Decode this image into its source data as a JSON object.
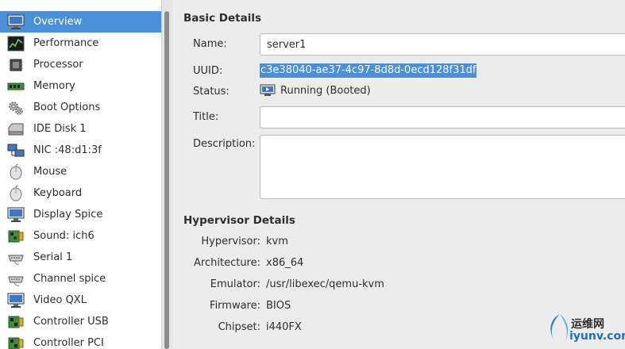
{
  "sidebar": {
    "items": [
      {
        "label": "Overview",
        "icon": "monitor-icon",
        "selected": true
      },
      {
        "label": "Performance",
        "icon": "performance-graph-icon"
      },
      {
        "label": "Processor",
        "icon": "cpu-chip-icon"
      },
      {
        "label": "Memory",
        "icon": "memory-stick-icon"
      },
      {
        "label": "Boot Options",
        "icon": "gears-icon"
      },
      {
        "label": "IDE Disk 1",
        "icon": "hard-disk-icon"
      },
      {
        "label": "NIC :48:d1:3f",
        "icon": "network-icon"
      },
      {
        "label": "Mouse",
        "icon": "mouse-icon"
      },
      {
        "label": "Keyboard",
        "icon": "keyboard-icon"
      },
      {
        "label": "Display Spice",
        "icon": "display-icon"
      },
      {
        "label": "Sound: ich6",
        "icon": "sound-card-icon"
      },
      {
        "label": "Serial 1",
        "icon": "serial-port-icon"
      },
      {
        "label": "Channel spice",
        "icon": "channel-icon"
      },
      {
        "label": "Video QXL",
        "icon": "video-card-icon"
      },
      {
        "label": "Controller USB",
        "icon": "controller-card-icon"
      },
      {
        "label": "Controller PCI",
        "icon": "controller-card-icon"
      }
    ]
  },
  "basic": {
    "title": "Basic Details",
    "name_label": "Name:",
    "name_value": "server1",
    "uuid_label": "UUID:",
    "uuid_value": "c3e38040-ae37-4c97-8d8d-0ecd128f31df",
    "status_label": "Status:",
    "status_value": "Running (Booted)",
    "title_label": "Title:",
    "title_value": "",
    "description_label": "Description:",
    "description_value": ""
  },
  "hypervisor": {
    "title": "Hypervisor Details",
    "hypervisor_label": "Hypervisor:",
    "hypervisor_value": "kvm",
    "architecture_label": "Architecture:",
    "architecture_value": "x86_64",
    "emulator_label": "Emulator:",
    "emulator_value": "/usr/libexec/qemu-kvm",
    "firmware_label": "Firmware:",
    "firmware_value": "BIOS",
    "chipset_label": "Chipset:",
    "chipset_value": "i440FX"
  },
  "watermark": {
    "cn_text": "运维网",
    "en_text": "iyunv.com"
  },
  "colors": {
    "selection": "#4a90d9",
    "watermark_blue": "#1d6fc4"
  }
}
